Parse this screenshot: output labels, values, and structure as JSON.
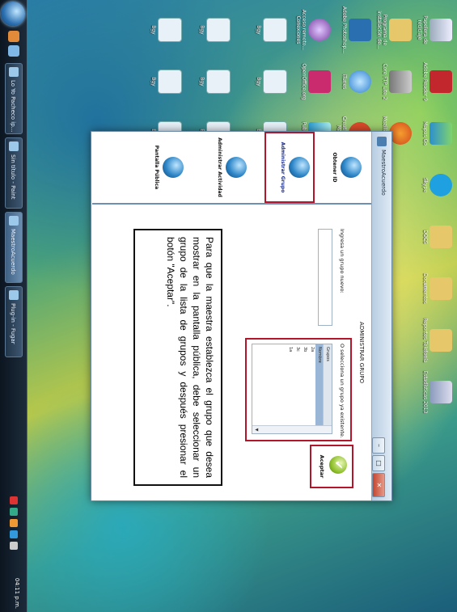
{
  "taskbar": {
    "items": [
      "Lo Yo Pacheco ip...",
      "Sin título - Paint",
      "MaestroAcuerdo",
      "Plug-in - Fugar"
    ],
    "clock": "04:11 p.m."
  },
  "desktop": {
    "icons": [
      "Papelera de reciclaje",
      "Adobe Reader 9",
      "Mapas Go",
      "Skype",
      "DOCS",
      "Documentos",
      "Reportes Telefonía",
      "Estadísticas 2013",
      "Programa de instalación de...",
      "Core FTP Lite 2",
      "Mozilla Firefox",
      "Adobe Photoshop...",
      "iTunes",
      "Creative Suite Master",
      "Acceso remoto... Conexiones",
      "OpenOffice.org",
      "Publicar...",
      "Bgy",
      "Bgy",
      "Bgy",
      "Bgy",
      "Bgy",
      "Bgy",
      "Bgy",
      "Bgy",
      "Bgy"
    ]
  },
  "window": {
    "title": "MaestroAcuerdo",
    "btn_min": "–",
    "btn_max": "□",
    "btn_close": "✕",
    "nav": [
      "Obtener ID",
      "Administrar Grupo",
      "Administrar Actividad",
      "Pantalla Pública"
    ],
    "content_title": "ADMINISTRAR GRUPO",
    "new_group_label": "Ingresa un grupo nuevo:",
    "select_group_label": "O selecciona un grupo ya existente.",
    "group_list_header": "Grupos",
    "groups": [
      "Nombre",
      "2a",
      "3b",
      "3c",
      "1a"
    ],
    "accept_label": "Aceptar",
    "accept_icon": "✔"
  },
  "note": "Para que la maestra establezca el grupo que desea mostrar en la pantalla pública, debe seleccionar un grupo de la lista de grupos y después presionar el botón \"Aceptar\"."
}
